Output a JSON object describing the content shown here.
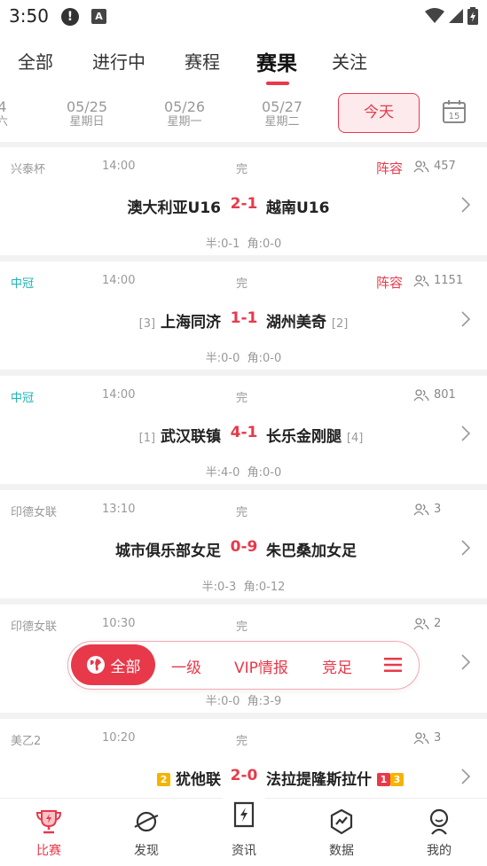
{
  "status_bar": {
    "time": "3:50"
  },
  "tabs": [
    {
      "label": "全部"
    },
    {
      "label": "进行中"
    },
    {
      "label": "赛程"
    },
    {
      "label": "赛果"
    },
    {
      "label": "关注"
    }
  ],
  "dates": [
    {
      "date": "4",
      "weekday": "六"
    },
    {
      "date": "05/25",
      "weekday": "星期日"
    },
    {
      "date": "05/26",
      "weekday": "星期一"
    },
    {
      "date": "05/27",
      "weekday": "星期二"
    }
  ],
  "today_label": "今天",
  "calendar_day": "15",
  "matches": [
    {
      "league": "兴泰杯",
      "time": "14:00",
      "status": "完",
      "lineup": "阵容",
      "viewers": "457",
      "home": "澳大利亚U16",
      "home_rank": "",
      "score": "2-1",
      "away": "越南U16",
      "away_rank": "",
      "half": "半:0-1",
      "corner": "角:0-0"
    },
    {
      "league": "中冠",
      "time": "14:00",
      "status": "完",
      "lineup": "阵容",
      "viewers": "1151",
      "home": "上海同济",
      "home_rank": "[3]",
      "score": "1-1",
      "away": "湖州美奇",
      "away_rank": "[2]",
      "half": "半:0-0",
      "corner": "角:0-0"
    },
    {
      "league": "中冠",
      "time": "14:00",
      "status": "完",
      "lineup": "",
      "viewers": "801",
      "home": "武汉联镇",
      "home_rank": "[1]",
      "score": "4-1",
      "away": "长乐金刚腿",
      "away_rank": "[4]",
      "half": "半:4-0",
      "corner": "角:0-0"
    },
    {
      "league": "印德女联",
      "time": "13:10",
      "status": "完",
      "lineup": "",
      "viewers": "3",
      "home": "城市俱乐部女足",
      "home_rank": "",
      "score": "0-9",
      "away": "朱巴桑加女足",
      "away_rank": "",
      "half": "半:0-3",
      "corner": "角:0-12"
    },
    {
      "league": "印德女联",
      "time": "10:30",
      "status": "完",
      "lineup": "",
      "viewers": "2",
      "home": "",
      "home_rank": "",
      "score": "",
      "away": "",
      "away_rank": "",
      "half": "半:0-0",
      "corner": "角:3-9"
    },
    {
      "league": "美乙2",
      "time": "10:20",
      "status": "完",
      "lineup": "",
      "viewers": "3",
      "home": "犹他联",
      "home_badge": "2",
      "score": "2-0",
      "away": "法拉提隆斯拉什",
      "away_badge_red": "1",
      "away_badge_yellow": "3",
      "half": "",
      "corner": ""
    }
  ],
  "filter": {
    "all": "全部",
    "items": [
      "一级",
      "VIP情报",
      "竞足"
    ]
  },
  "bottom_nav": [
    {
      "label": "比赛"
    },
    {
      "label": "发现"
    },
    {
      "label": "资讯"
    },
    {
      "label": "数据"
    },
    {
      "label": "我的"
    }
  ],
  "colors": {
    "accent": "#e8394a",
    "teal": "#1bb4b4",
    "muted": "#999999"
  }
}
